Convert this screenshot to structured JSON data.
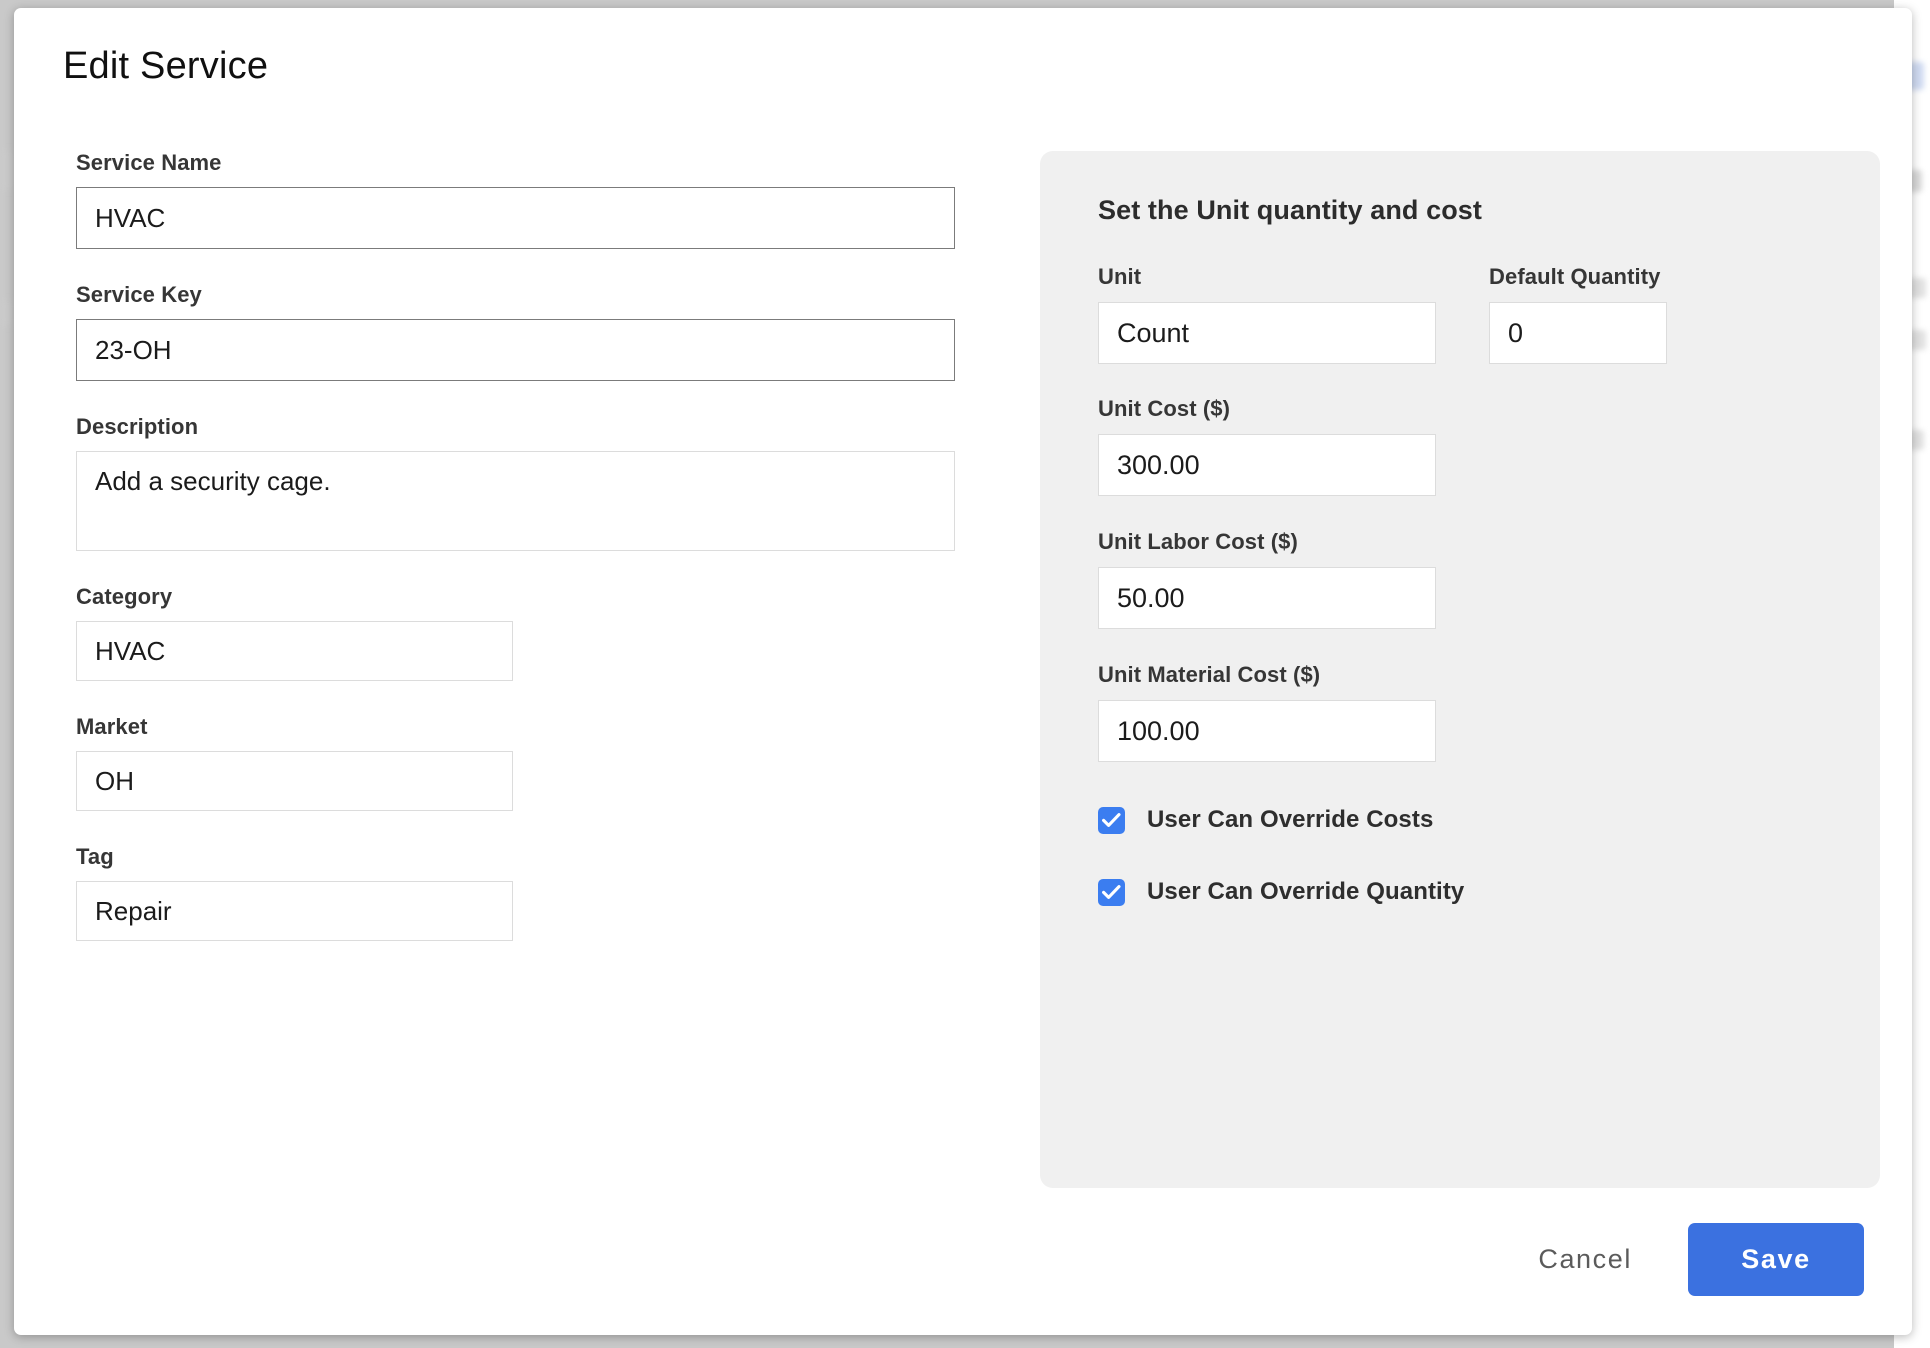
{
  "modal": {
    "title": "Edit Service"
  },
  "form": {
    "fields": [
      {
        "label": "Service Name",
        "value": "HVAC",
        "type": "text"
      },
      {
        "label": "Service Key",
        "value": "23-OH",
        "type": "text"
      },
      {
        "label": "Description",
        "value": "Add a security cage.",
        "type": "textarea"
      },
      {
        "label": "Category",
        "value": "HVAC",
        "type": "text"
      },
      {
        "label": "Market",
        "value": "OH",
        "type": "text"
      },
      {
        "label": "Tag",
        "value": "Repair",
        "type": "text"
      }
    ]
  },
  "cost_panel": {
    "title": "Set the Unit quantity and cost",
    "unit": {
      "label": "Unit",
      "value": "Count"
    },
    "default_quantity": {
      "label": "Default Quantity",
      "value": "0"
    },
    "unit_cost": {
      "label": "Unit Cost ($)",
      "value": "300.00"
    },
    "unit_labor_cost": {
      "label": "Unit Labor Cost ($)",
      "value": "50.00"
    },
    "unit_material_cost": {
      "label": "Unit Material Cost ($)",
      "value": "100.00"
    },
    "checkboxes": [
      {
        "label": "User Can Override Costs",
        "checked": true,
        "icon": "check-icon"
      },
      {
        "label": "User Can Override Quantity",
        "checked": true,
        "icon": "check-icon"
      }
    ]
  },
  "footer": {
    "cancel_label": "Cancel",
    "save_label": "Save"
  },
  "colors": {
    "accent_blue": "#3b71e0",
    "checkbox_blue": "#3b7df0",
    "panel_bg": "#f0f0f0",
    "input_border_strong": "#7b7b7b",
    "input_border_light": "#dcdcdc"
  }
}
